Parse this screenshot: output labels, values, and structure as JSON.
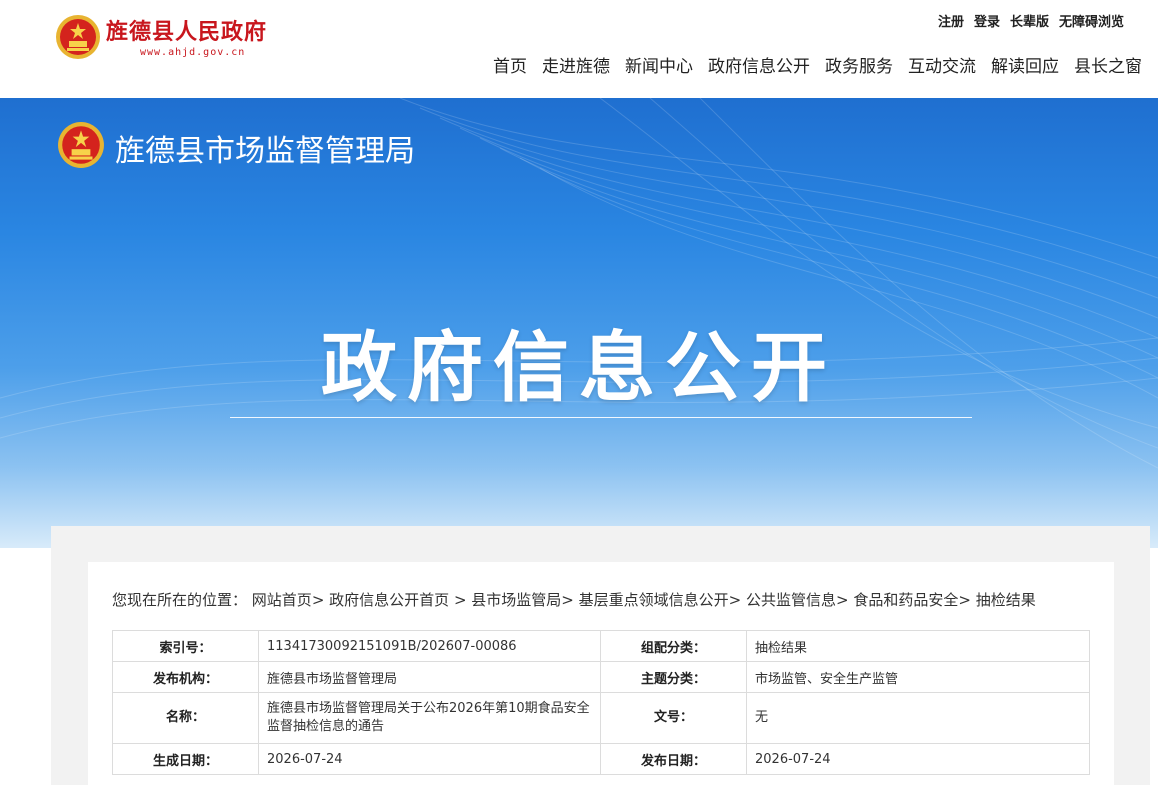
{
  "header": {
    "site_name": "旌德县人民政府",
    "site_url": "www.ahjd.gov.cn",
    "util_links": [
      "注册",
      "登录",
      "长辈版",
      "无障碍浏览"
    ],
    "nav": [
      "首页",
      "走进旌德",
      "新闻中心",
      "政府信息公开",
      "政务服务",
      "互动交流",
      "解读回应",
      "县长之窗"
    ]
  },
  "banner": {
    "bureau_name": "旌德县市场监督管理局",
    "title": "政府信息公开"
  },
  "breadcrumb": {
    "prefix": "您现在所在的位置：",
    "items": [
      "网站首页",
      "政府信息公开首页",
      "县市场监管局",
      "基层重点领域信息公开",
      "公共监管信息",
      "食品和药品安全",
      "抽检结果"
    ]
  },
  "meta": {
    "index_label": "索引号：",
    "index_value": "11341730092151091B/202607-00086",
    "category_label": "组配分类：",
    "category_value": "抽检结果",
    "publisher_label": "发布机构：",
    "publisher_value": "旌德县市场监督管理局",
    "topic_label": "主题分类：",
    "topic_value": "市场监管、安全生产监管",
    "name_label": "名称：",
    "name_value": "旌德县市场监督管理局关于公布2026年第10期食品安全监督抽检信息的通告",
    "doc_no_label": "文号：",
    "doc_no_value": "无",
    "created_label": "生成日期：",
    "created_value": "2026-07-24",
    "published_label": "发布日期：",
    "published_value": "2026-07-24"
  },
  "colors": {
    "brand_red": "#c8161d",
    "banner_blue": "#2a86e2"
  }
}
